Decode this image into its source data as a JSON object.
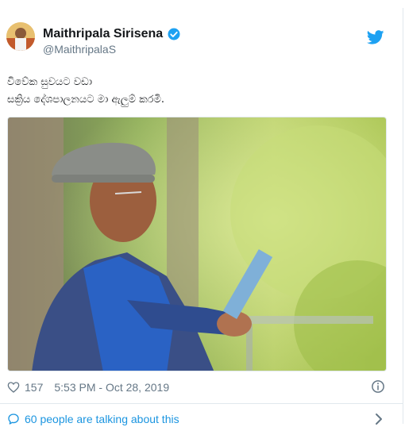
{
  "author": {
    "name": "Maithripala Sirisena",
    "handle": "@MaithripalaS",
    "verified": true
  },
  "tweet": {
    "lines": [
      "විවේක සුවයට වඩා",
      "සක්‍රිය දේශපාලනයට මා ඇලුම් කරමි."
    ]
  },
  "footer": {
    "likes": "157",
    "timestamp": "5:53 PM - Oct 28, 2019",
    "talking": "60 people are talking about this"
  },
  "icons": {
    "verified": "verified-badge-icon",
    "brand": "twitter-bird-icon",
    "like": "heart-icon",
    "info": "info-icon",
    "conversation": "speech-bubble-icon",
    "more": "chevron-right-icon"
  },
  "colors": {
    "accent": "#1da1f2",
    "link": "#1b95e0",
    "muted": "#657786",
    "border": "#e1e8ed"
  }
}
